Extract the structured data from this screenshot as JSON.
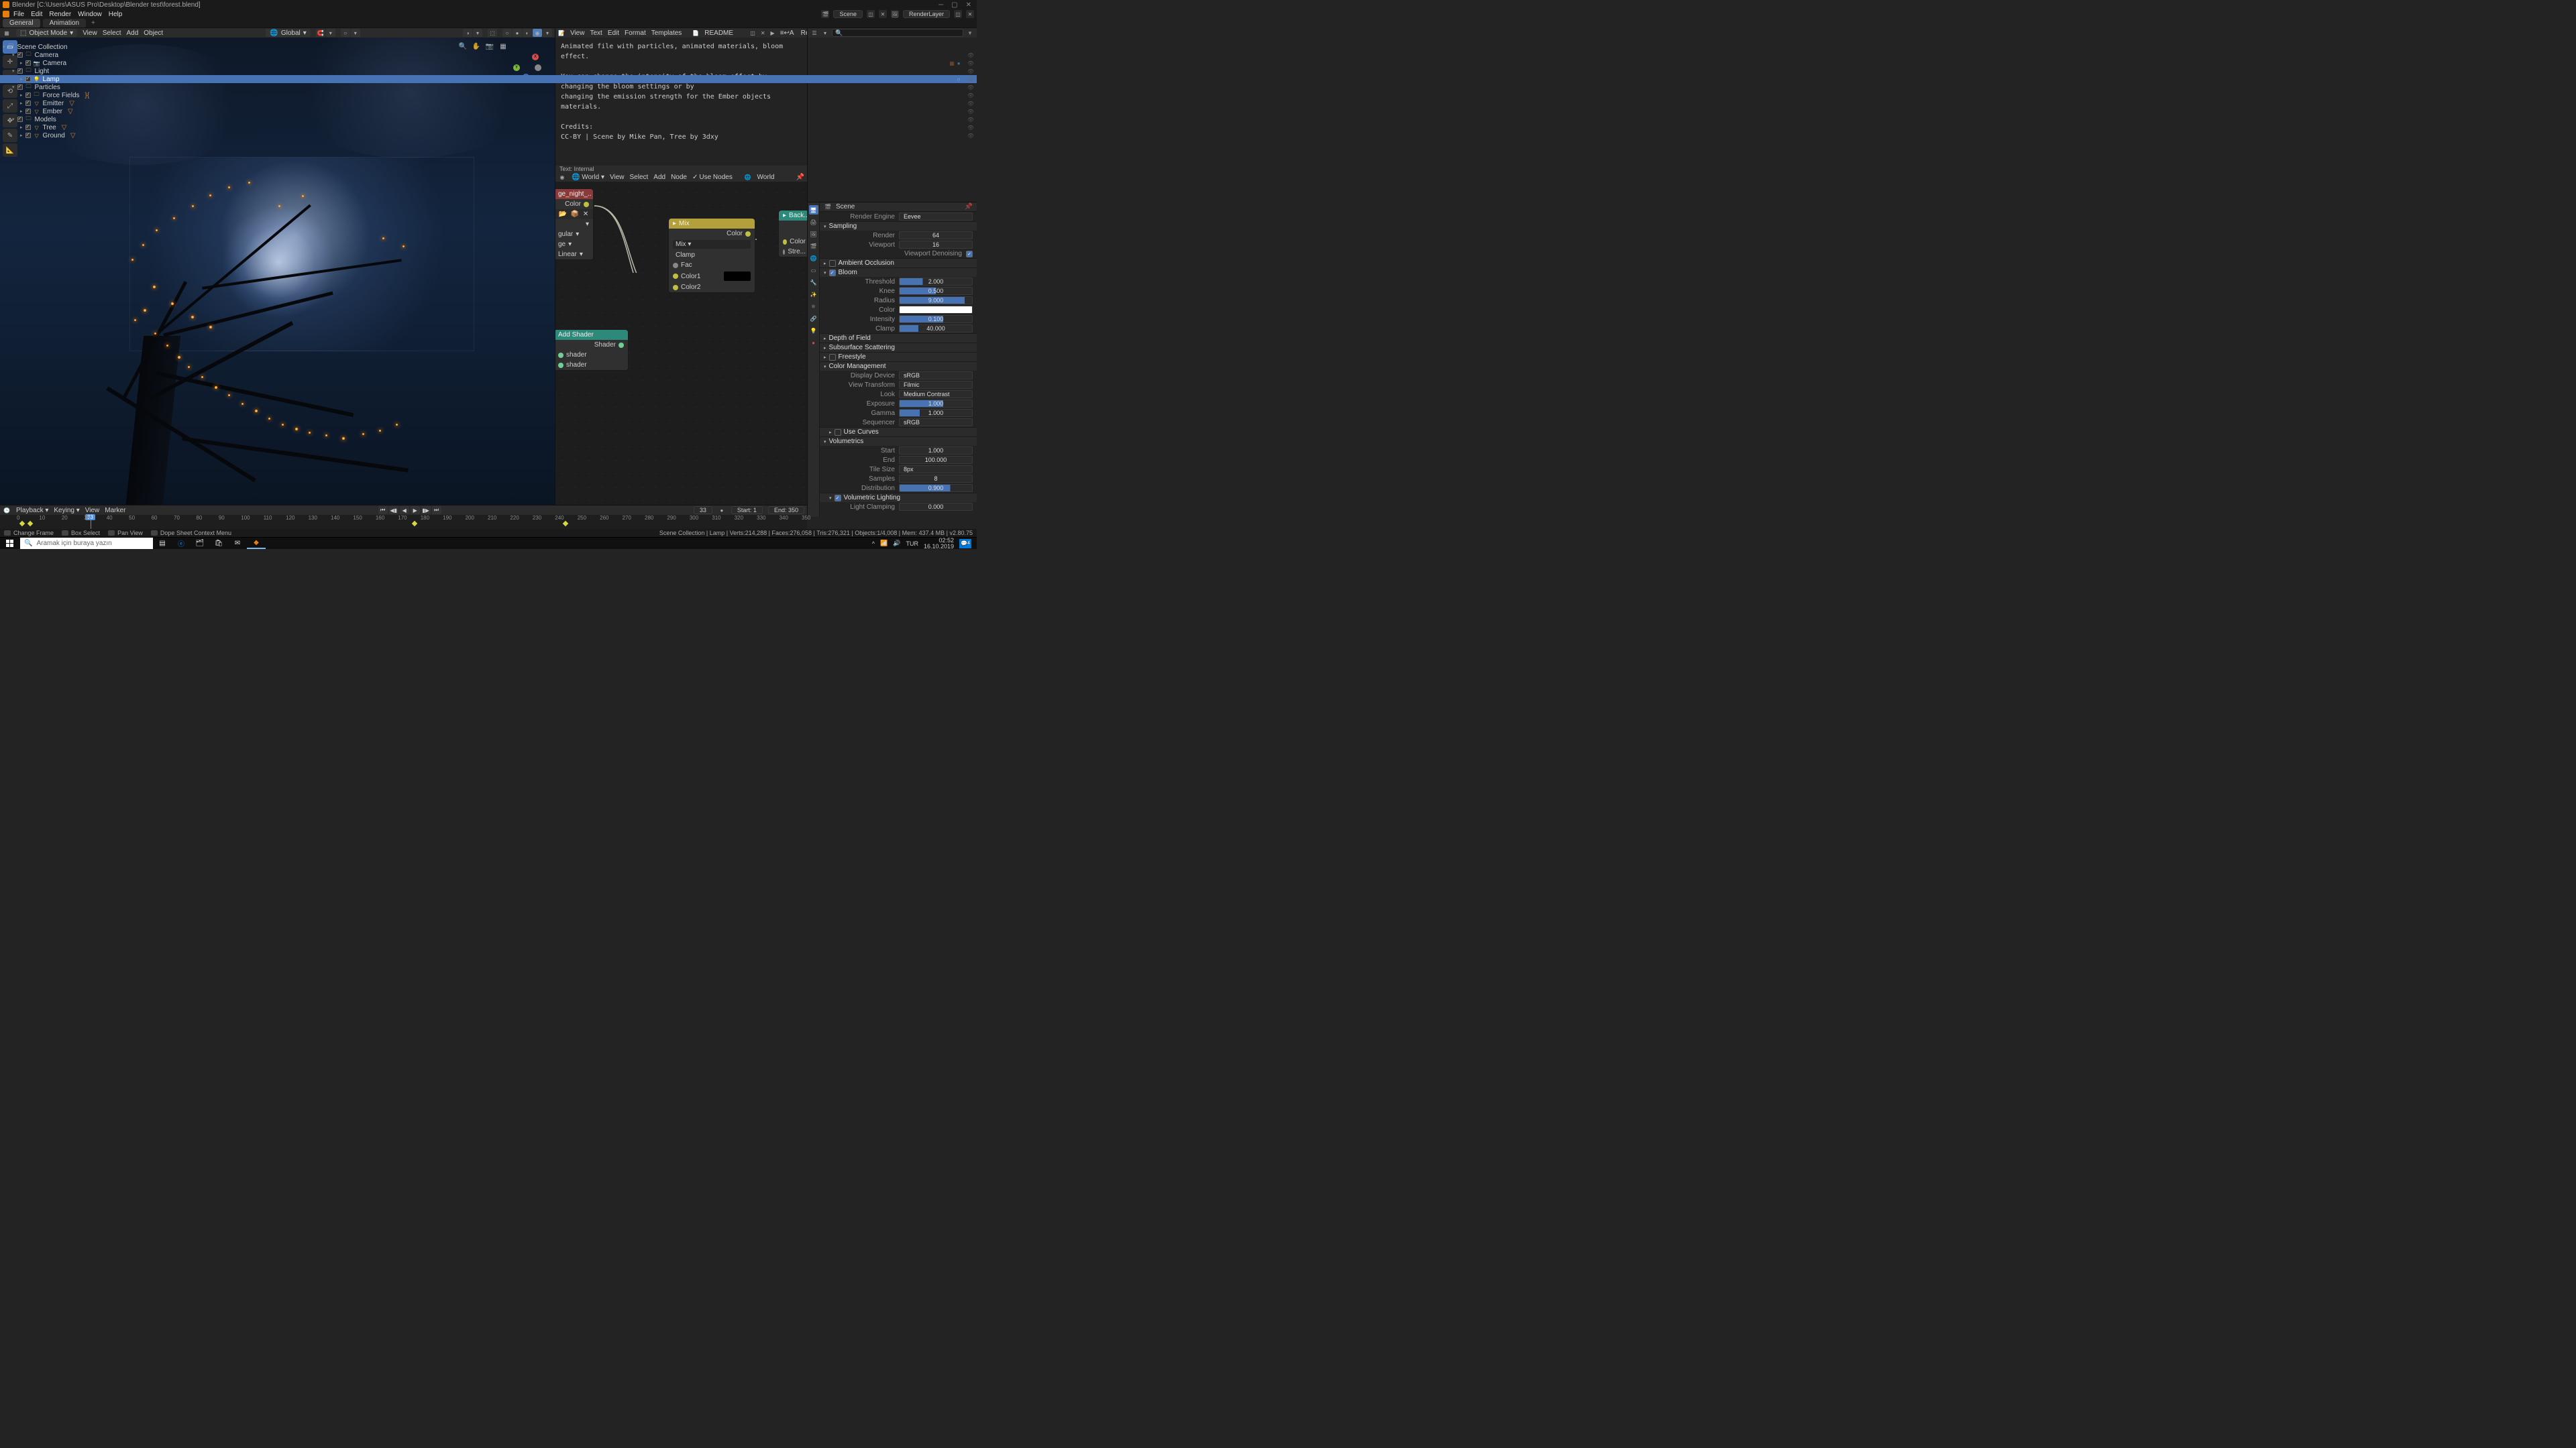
{
  "window": {
    "title": "Blender [C:\\Users\\ASUS Pro\\Desktop\\Blender test\\forest.blend]"
  },
  "top_menu": [
    "File",
    "Edit",
    "Render",
    "Window",
    "Help"
  ],
  "workspaces": {
    "active": "General",
    "tabs": [
      "General",
      "Animation"
    ]
  },
  "top_right": {
    "scene_label": "Scene",
    "layer_label": "RenderLayer"
  },
  "viewport_header": {
    "mode": "Object Mode",
    "menus": [
      "View",
      "Select",
      "Add",
      "Object"
    ],
    "orientation": "Global"
  },
  "text_editor": {
    "menus": [
      "View",
      "Text",
      "Edit",
      "Format",
      "Templates"
    ],
    "file": "README",
    "register_label": "Register",
    "body": "Animated file with particles, animated materials, bloom effect.\n\nYou can change the intensity of the bloom effect by changing the bloom settings or by\nchanging the emission strength for the Ember objects materials.\n\nCredits:\nCC-BY | Scene by Mike Pan, Tree by 3dxy",
    "footer": "Text: Internal"
  },
  "node_editor": {
    "menus": [
      "View",
      "Select",
      "Add",
      "Node"
    ],
    "use_nodes": "Use Nodes",
    "datablock": "World",
    "world_label": "World",
    "nodes": {
      "env": {
        "title": "ge_night_..",
        "out": "Color",
        "linear": "Linear"
      },
      "mix": {
        "title": "Mix",
        "out": "Color",
        "mode": "Mix",
        "clamp": "Clamp",
        "fac": "Fac",
        "c1": "Color1",
        "c2": "Color2"
      },
      "bg": {
        "title": "Back...",
        "color": "Color",
        "strength": "Stre..."
      },
      "add": {
        "title": "Add Shader",
        "out": "Shader",
        "in1": "shader",
        "in2": "shader"
      },
      "footer": "World"
    }
  },
  "outliner": {
    "root": "Scene Collection",
    "items": [
      {
        "name": "Camera",
        "type": "collection",
        "depth": 1
      },
      {
        "name": "Camera",
        "type": "camera",
        "depth": 2
      },
      {
        "name": "Light",
        "type": "collection",
        "depth": 1
      },
      {
        "name": "Lamp",
        "type": "light",
        "depth": 2,
        "selected": true
      },
      {
        "name": "Particles",
        "type": "collection",
        "depth": 1
      },
      {
        "name": "Force Fields",
        "type": "collection",
        "depth": 2
      },
      {
        "name": "Emitter",
        "type": "mesh",
        "depth": 2
      },
      {
        "name": "Ember",
        "type": "mesh",
        "depth": 2
      },
      {
        "name": "Models",
        "type": "collection",
        "depth": 1
      },
      {
        "name": "Tree",
        "type": "mesh",
        "depth": 2
      },
      {
        "name": "Ground",
        "type": "mesh",
        "depth": 2
      }
    ]
  },
  "properties": {
    "crumb": "Scene",
    "render_engine": {
      "label": "Render Engine",
      "value": "Eevee"
    },
    "sampling": {
      "title": "Sampling",
      "render": {
        "label": "Render",
        "value": "64"
      },
      "viewport": {
        "label": "Viewport",
        "value": "16"
      },
      "denoise": "Viewport Denoising"
    },
    "ao": {
      "title": "Ambient Occlusion",
      "on": false
    },
    "bloom": {
      "title": "Bloom",
      "on": true,
      "threshold": {
        "label": "Threshold",
        "value": "2.000"
      },
      "knee": {
        "label": "Knee",
        "value": "0.500"
      },
      "radius": {
        "label": "Radius",
        "value": "9.000"
      },
      "color": {
        "label": "Color"
      },
      "intensity": {
        "label": "Intensity",
        "value": "0.100"
      },
      "clamp": {
        "label": "Clamp",
        "value": "40.000"
      }
    },
    "dof": "Depth of Field",
    "sss": "Subsurface Scattering",
    "freestyle": "Freestyle",
    "cm": {
      "title": "Color Management",
      "device": {
        "label": "Display Device",
        "value": "sRGB"
      },
      "vt": {
        "label": "View Transform",
        "value": "Filmic"
      },
      "look": {
        "label": "Look",
        "value": "Medium Contrast"
      },
      "exposure": {
        "label": "Exposure",
        "value": "1.000"
      },
      "gamma": {
        "label": "Gamma",
        "value": "1.000"
      },
      "seq": {
        "label": "Sequencer",
        "value": "sRGB"
      },
      "curves": "Use Curves"
    },
    "volumetrics": {
      "title": "Volumetrics",
      "start": {
        "label": "Start",
        "value": "1.000"
      },
      "end": {
        "label": "End",
        "value": "100.000"
      },
      "tile": {
        "label": "Tile Size",
        "value": "8px"
      },
      "samples": {
        "label": "Samples",
        "value": "8"
      },
      "dist": {
        "label": "Distribution",
        "value": "0.900"
      },
      "lighting": "Volumetric Lighting",
      "clamping": {
        "label": "Light Clamping",
        "value": "0.000"
      }
    }
  },
  "timeline": {
    "menus": [
      "Playback",
      "Keying",
      "View",
      "Marker"
    ],
    "current": "33",
    "start_label": "Start:",
    "start": "1",
    "end_label": "End:",
    "end": "350",
    "ticks": [
      "0",
      "10",
      "20",
      "30",
      "40",
      "50",
      "60",
      "70",
      "80",
      "90",
      "100",
      "110",
      "120",
      "130",
      "140",
      "150",
      "160",
      "170",
      "180",
      "190",
      "200",
      "210",
      "220",
      "230",
      "240",
      "250",
      "260",
      "270",
      "280",
      "290",
      "300",
      "310",
      "320",
      "330",
      "340",
      "350"
    ]
  },
  "status": {
    "hints": [
      {
        "icon": "🖱",
        "text": "Change Frame"
      },
      {
        "icon": "🖱",
        "text": "Box Select"
      },
      {
        "icon": "🖱",
        "text": "Pan View"
      },
      {
        "icon": "🖱",
        "text": "Dope Sheet Context Menu"
      }
    ],
    "right": "Scene Collection | Lamp | Verts:214,288 | Faces:276,058 | Tris:276,321 | Objects:1/4,008 | Mem: 437.4 MB | v2.80.75"
  },
  "os": {
    "search_placeholder": "Aramak için buraya yazın",
    "time": "02:52",
    "date": "16.10.2019",
    "notif": "4"
  }
}
